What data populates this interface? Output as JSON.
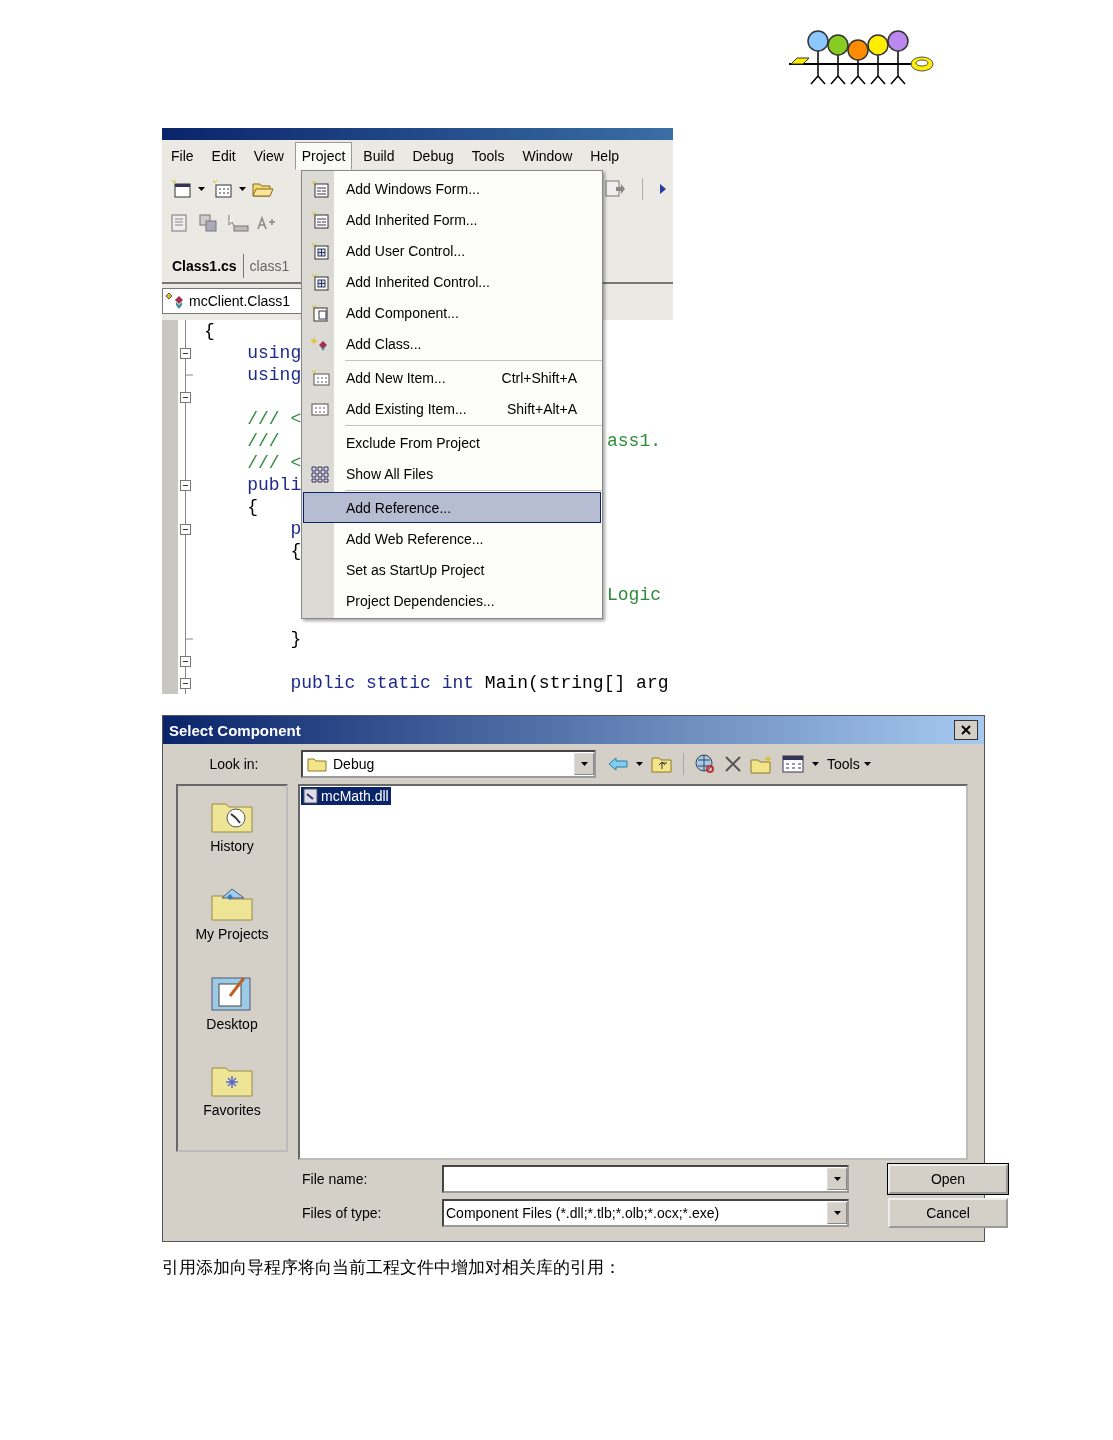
{
  "ide": {
    "menu_bar": [
      {
        "label": "File",
        "selected": false
      },
      {
        "label": "Edit",
        "selected": false
      },
      {
        "label": "View",
        "selected": false
      },
      {
        "label": "Project",
        "selected": true
      },
      {
        "label": "Build",
        "selected": false
      },
      {
        "label": "Debug",
        "selected": false
      },
      {
        "label": "Tools",
        "selected": false
      },
      {
        "label": "Window",
        "selected": false
      },
      {
        "label": "Help",
        "selected": false
      }
    ],
    "editor_tabs": [
      {
        "label": "Class1.cs",
        "selected": true
      },
      {
        "label": "class1",
        "selected": false
      }
    ],
    "type_dropdown": {
      "value": "mcClient.Class1"
    },
    "code_lines": [
      {
        "kind": "line",
        "tokens": [
          {
            "text": "{",
            "kind": "plain"
          }
        ]
      },
      {
        "kind": "box",
        "tokens": [
          {
            "text": "    using",
            "kind": "keyword"
          }
        ]
      },
      {
        "kind": "end",
        "tokens": [
          {
            "text": "    using",
            "kind": "keyword"
          }
        ]
      },
      {
        "kind": "box"
      },
      {
        "kind": "line",
        "tokens": [
          {
            "text": "    /// <",
            "kind": "comment"
          }
        ]
      },
      {
        "kind": "line",
        "tokens": [
          {
            "text": "    ///",
            "kind": "comment"
          }
        ],
        "tail": {
          "text": "ass1.",
          "kind": "comment"
        }
      },
      {
        "kind": "line",
        "tokens": [
          {
            "text": "    /// <",
            "kind": "comment"
          }
        ]
      },
      {
        "kind": "box",
        "tokens": [
          {
            "text": "    publi",
            "kind": "keyword"
          }
        ]
      },
      {
        "kind": "line",
        "tokens": [
          {
            "text": "    {",
            "kind": "plain"
          }
        ]
      },
      {
        "kind": "box",
        "tokens": [
          {
            "text": "        p",
            "kind": "keyword"
          }
        ]
      },
      {
        "kind": "line",
        "tokens": [
          {
            "text": "        {",
            "kind": "plain"
          }
        ]
      },
      {
        "kind": "line"
      },
      {
        "kind": "line",
        "tail": {
          "text": "Logic",
          "kind": "comment"
        }
      },
      {
        "kind": "line"
      },
      {
        "kind": "end",
        "tokens": [
          {
            "text": "        }",
            "kind": "plain"
          }
        ]
      },
      {
        "kind": "box"
      },
      {
        "kind": "box",
        "tokens": [
          {
            "text": "        public static int",
            "kind": "keyword"
          },
          {
            "text": " Main(string[] arg",
            "kind": "plain"
          }
        ]
      }
    ],
    "project_menu": [
      {
        "label": "Add Windows Form...",
        "kind": "form",
        "separator_before": false,
        "selected": false
      },
      {
        "label": "Add Inherited Form...",
        "kind": "form",
        "separator_before": false,
        "selected": false
      },
      {
        "label": "Add User Control...",
        "kind": "control",
        "separator_before": false,
        "selected": false
      },
      {
        "label": "Add Inherited Control...",
        "kind": "control",
        "separator_before": false,
        "selected": false
      },
      {
        "label": "Add Component...",
        "kind": "component",
        "separator_before": false,
        "selected": false
      },
      {
        "label": "Add Class...",
        "kind": "class",
        "separator_before": false,
        "selected": false
      },
      {
        "label": "Add New Item...",
        "shortcut": "Ctrl+Shift+A",
        "kind": "new-item",
        "separator_before": true,
        "selected": false
      },
      {
        "label": "Add Existing Item...",
        "shortcut": "Shift+Alt+A",
        "kind": "existing-item",
        "separator_before": false,
        "selected": false
      },
      {
        "label": "Exclude From Project",
        "kind": "plain",
        "separator_before": true,
        "selected": false
      },
      {
        "label": "Show All Files",
        "kind": "show-files",
        "separator_before": false,
        "selected": false
      },
      {
        "label": "Add Reference...",
        "kind": "plain",
        "separator_before": true,
        "selected": true
      },
      {
        "label": "Add Web Reference...",
        "kind": "plain",
        "separator_before": false,
        "selected": false
      },
      {
        "label": "Set as StartUp Project",
        "kind": "plain",
        "separator_before": false,
        "selected": false
      },
      {
        "label": "Project Dependencies...",
        "kind": "plain",
        "separator_before": false,
        "selected": false
      }
    ]
  },
  "dialog": {
    "title": "Select Component",
    "look_in": {
      "label": "Look in:",
      "value": "Debug"
    },
    "tools_label": "Tools",
    "places": [
      {
        "label": "History",
        "kind": "history"
      },
      {
        "label": "My Projects",
        "kind": "projects"
      },
      {
        "label": "Desktop",
        "kind": "desktop"
      },
      {
        "label": "Favorites",
        "kind": "favorites"
      }
    ],
    "files": [
      {
        "name": "mcMath.dll",
        "selected": true
      }
    ],
    "file_name": {
      "label": "File name:"
    },
    "file_type": {
      "label": "Files of type:",
      "value": "Component Files (*.dll;*.tlb;*.olb;*.ocx;*.exe)"
    },
    "buttons": [
      {
        "label": "Open",
        "default": true
      },
      {
        "label": "Cancel",
        "default": false
      }
    ]
  },
  "caption": "引用添加向导程序将向当前工程文件中增加对相关库的引用："
}
